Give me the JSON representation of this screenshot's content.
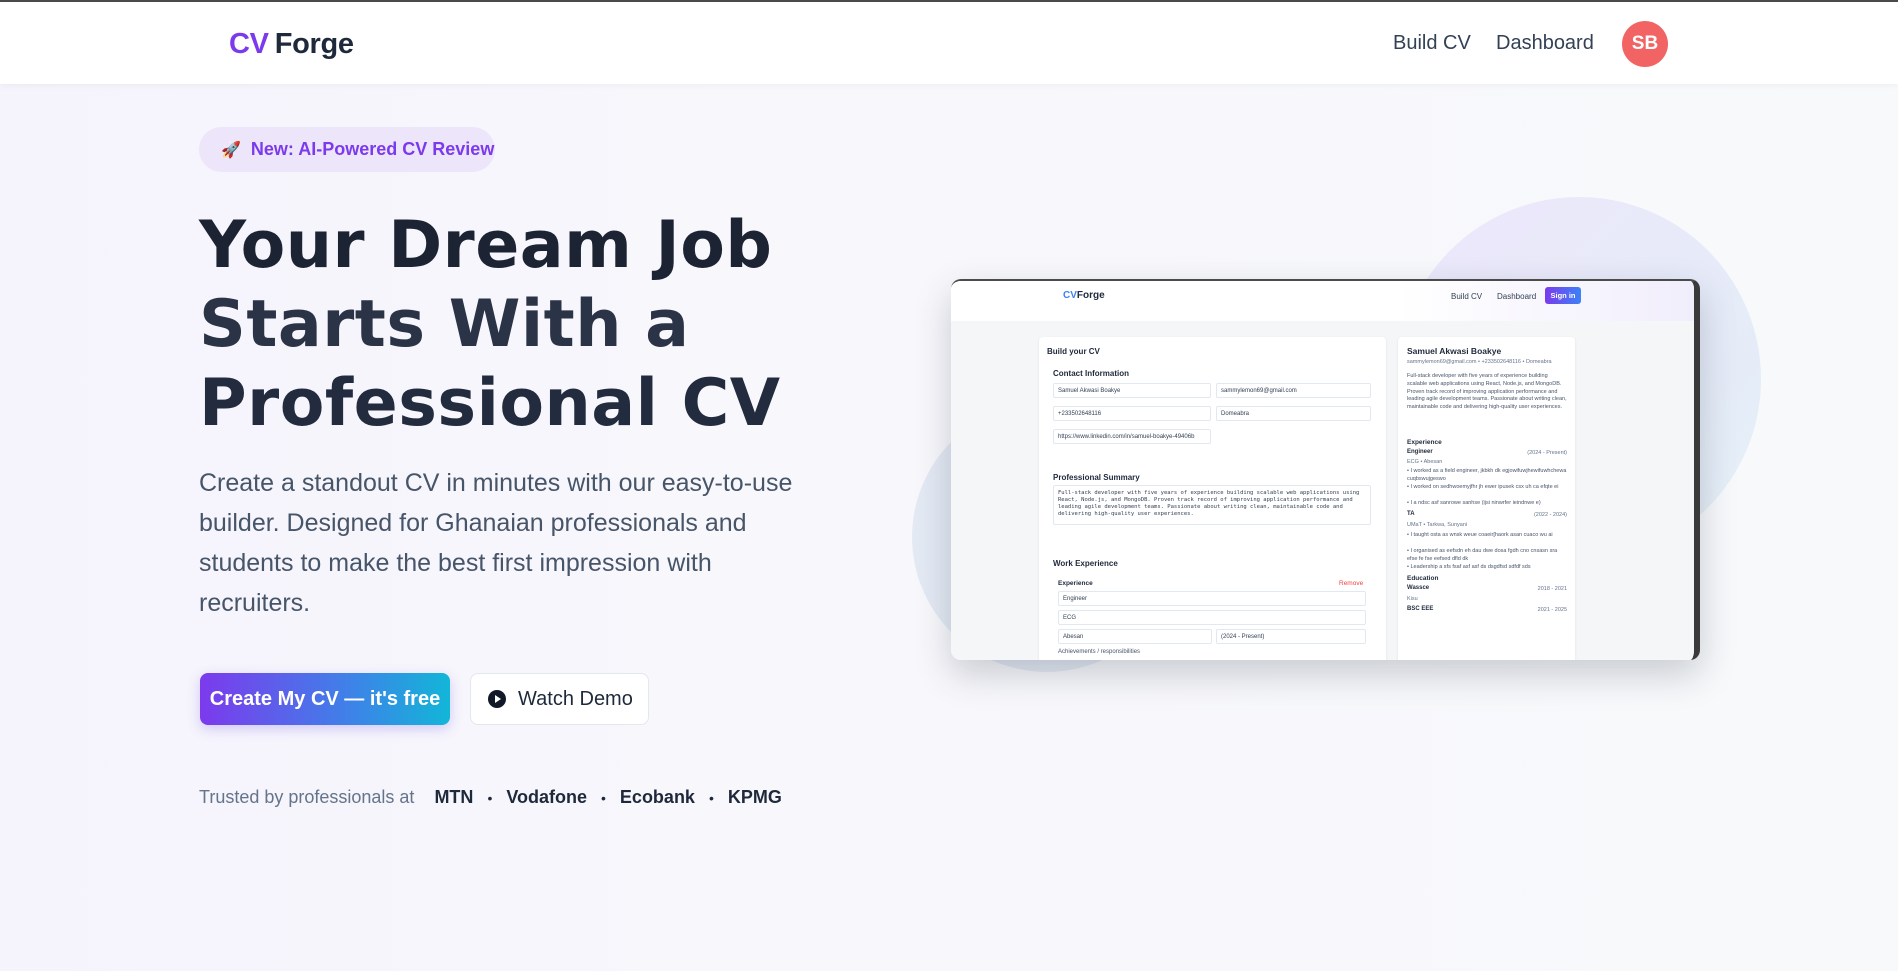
{
  "header": {
    "logo_cv": "CV",
    "logo_forge": "Forge",
    "nav": [
      "Build CV",
      "Dashboard"
    ],
    "avatar_initials": "SB"
  },
  "hero": {
    "badge_icon": "rocket-icon",
    "badge_text": "New: AI-Powered CV Review",
    "title_lines": [
      "Your Dream Job",
      "Starts With a",
      "Professional CV"
    ],
    "description": "Create a standout CV in minutes with our easy-to-use builder. Designed for Ghanaian professionals and students to make the best first impression with recruiters.",
    "cta_primary": "Create My CV — it's free",
    "cta_secondary": "Watch Demo",
    "trusted_label": "Trusted by professionals at",
    "companies": [
      "MTN",
      "Vodafone",
      "Ecobank",
      "KPMG"
    ]
  },
  "preview": {
    "nav_logo_cv": "CV",
    "nav_logo_forge": "Forge",
    "nav_links": [
      "Build CV",
      "Dashboard"
    ],
    "sign_in": "Sign in",
    "form": {
      "title": "Build your CV",
      "contact_heading": "Contact Information",
      "full_name": "Samuel Akwasi Boakye",
      "email": "sammylemon69@gmail.com",
      "phone": "+233502648116",
      "location": "Domeabra",
      "linkedin": "https://www.linkedin.com/in/samuel-boakye-49406b",
      "summary_heading": "Professional Summary",
      "summary": "Full-stack developer with five years of experience building scalable web applications using React, Node.js, and MongoDB. Proven track record of improving application performance and leading agile development teams. Passionate about writing clean, maintainable code and delivering high-quality user experiences.",
      "work_heading": "Work Experience",
      "experience_label": "Experience",
      "remove_label": "Remove",
      "job_title": "Engineer",
      "company": "ECG",
      "job_location": "Abesan",
      "job_dates": "(2024 - Present)",
      "achievements_label": "Achievements / responsibilities"
    },
    "cv": {
      "name": "Samuel Akwasi Boakye",
      "contact": "sammylemon69@gmail.com • +233502648116 • Domeabra",
      "summary": "Full-stack developer with five years of experience building scalable web applications using React, Node.js, and MongoDB. Proven track record of improving application performance and leading agile development teams. Passionate about writing clean, maintainable code and delivering high-quality user experiences.",
      "experience_heading": "Experience",
      "job1_title": "Engineer",
      "job1_dates": "(2024 - Present)",
      "job1_company": "ECG • Abesan",
      "job1_bullets": [
        "I worked as a field engineer, jkbkh dk egjowifuwjhewifuwhchewa cuqbswujgeswo",
        "I worked on sedhwoemyjfhr jh ewer ipusek csx uh ca efqte ei",
        "I a ndsc asf sanrowe sanhse (ijsi ninwrfer ieindnwe e)"
      ],
      "job2_title": "TA",
      "job2_dates": "(2022 - 2024)",
      "job2_company": "UMaT • Tarkwa, Sunyani",
      "job2_bullets": [
        "I taught osta as wnsk weue coaeir[haork asan cuaco wu ai",
        "I organised as eefsdn eh dau dwe dosa fgdh cno cnsasn sra efse fe fse eefsed dfld dk",
        "Leadership a sfs fsaf asf asf ds dsgdfsd sdfdf sds"
      ],
      "education_heading": "Education",
      "edu1_school": "Wassce",
      "edu1_dates": "2018 - 2021",
      "edu1_location": "Kisu",
      "edu2_school": "BSC EEE",
      "edu2_dates": "2021 - 2025"
    }
  },
  "colors": {
    "brand_purple": "#7c3aed",
    "avatar_red": "#f26464",
    "cta_gradient_start": "#7c3aed",
    "cta_gradient_end": "#12b6d8"
  }
}
